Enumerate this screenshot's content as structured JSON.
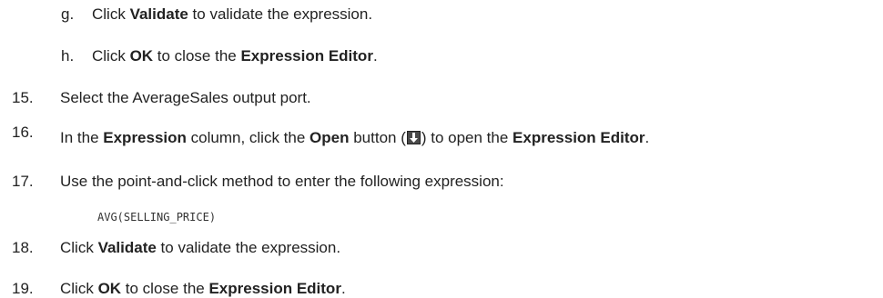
{
  "steps": [
    {
      "marker": "g.",
      "parts": [
        "Click ",
        "Validate",
        " to validate the expression."
      ]
    },
    {
      "marker": "h.",
      "parts": [
        "Click ",
        "OK",
        " to close the ",
        "Expression Editor",
        "."
      ]
    },
    {
      "marker": "15.",
      "parts": [
        "Select the AverageSales output port."
      ]
    },
    {
      "marker": "16.",
      "parts": [
        "In the ",
        "Expression",
        " column, click the ",
        "Open",
        " button (",
        ") to open the ",
        "Expression Editor",
        "."
      ],
      "icon": "open-button-icon"
    },
    {
      "marker": "17.",
      "parts": [
        "Use the point-and-click method to enter the following expression:"
      ]
    },
    {
      "marker": "18.",
      "parts": [
        "Click ",
        "Validate",
        " to validate the expression."
      ]
    },
    {
      "marker": "19.",
      "parts": [
        "Click ",
        "OK",
        " to close the ",
        "Expression Editor",
        "."
      ]
    }
  ],
  "code": "AVG(SELLING_PRICE)",
  "colors": {
    "text": "#222222",
    "icon_background": "#4a4a4a",
    "icon_arrow": "#ffffff"
  }
}
